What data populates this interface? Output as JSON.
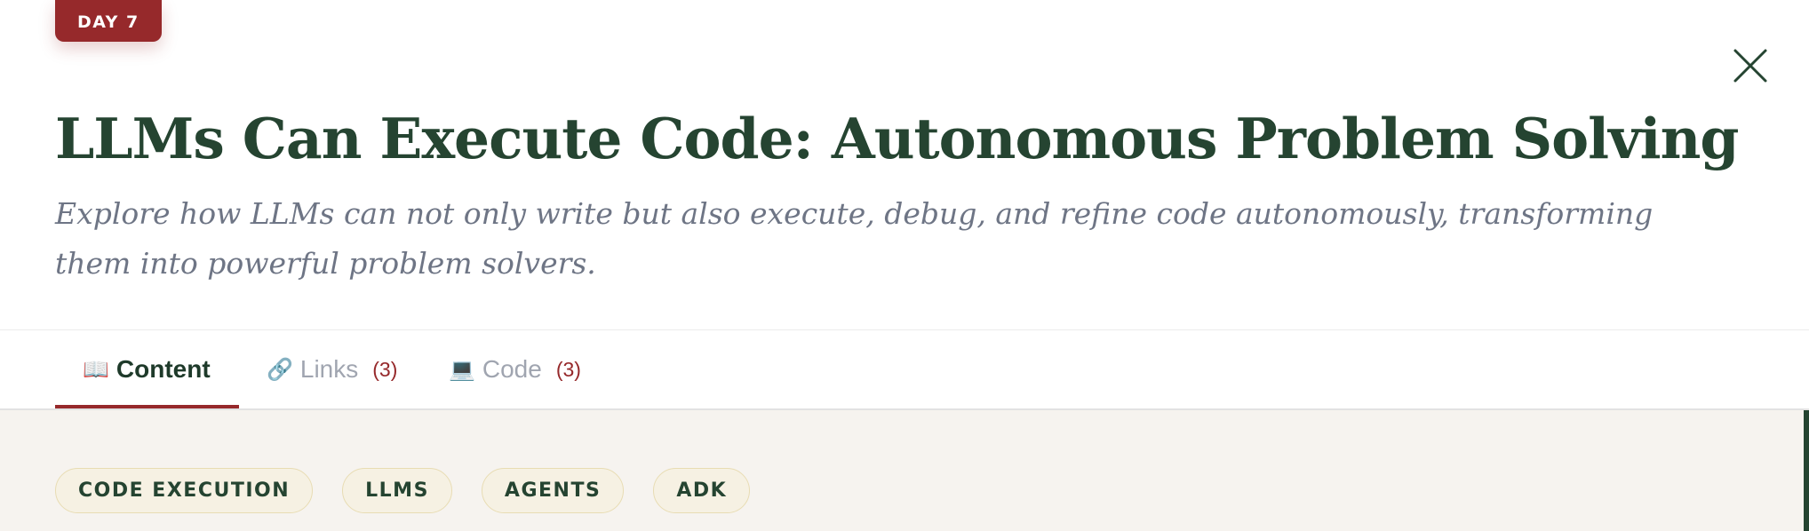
{
  "badge": {
    "label": "DAY 7"
  },
  "header": {
    "title": "LLMs Can Execute Code: Autonomous Problem Solving",
    "subtitle": "Explore how LLMs can not only write but also execute, debug, and refine code autonomously, transforming them into powerful problem solvers."
  },
  "tabs": [
    {
      "icon": "📖",
      "icon_name": "book-icon",
      "label": "Content",
      "count": "",
      "active": true
    },
    {
      "icon": "🔗",
      "icon_name": "link-icon",
      "label": "Links",
      "count": "(3)",
      "active": false
    },
    {
      "icon": "💻",
      "icon_name": "laptop-icon",
      "label": "Code",
      "count": "(3)",
      "active": false
    }
  ],
  "tags": [
    "CODE EXECUTION",
    "LLMS",
    "AGENTS",
    "ADK"
  ],
  "colors": {
    "accent": "#96292b",
    "title": "#254431",
    "subtitle": "#6e7585",
    "inactive_tab": "#a0a5b0",
    "content_bg": "#f6f3ef",
    "tag_bg": "#f6f1e3",
    "tag_border": "#e8dcb3"
  }
}
